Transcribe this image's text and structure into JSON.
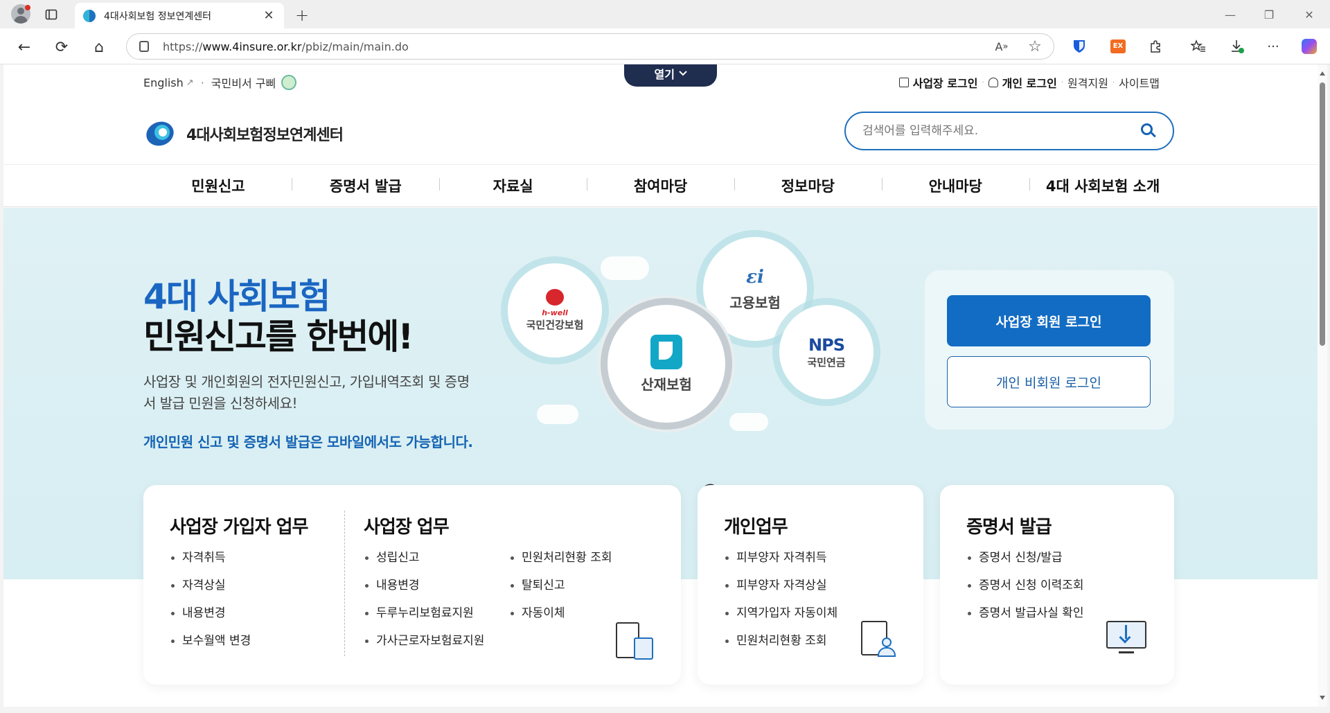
{
  "browser": {
    "tab_title": "4대사회보험 정보연계센터",
    "tab_close": "✕",
    "new_tab": "+",
    "url_prefix": "https://",
    "url_host": "www.4insure.or.kr",
    "url_path": "/pbiz/main/main.do",
    "window_controls": [
      "—",
      "❐",
      "✕"
    ],
    "nav": [
      "←",
      "⟳",
      "⌂"
    ],
    "toolbar_icons": [
      "read-aloud-icon",
      "favorite-star-icon",
      "bitwarden-icon",
      "ex-extension-icon",
      "extensions-icon",
      "favorites-icon",
      "downloads-icon",
      "more-icon",
      "copilot-icon"
    ],
    "ex_label": "EX",
    "more_label": "···"
  },
  "util": {
    "english": "English",
    "ext_link": "↗",
    "sep": "·",
    "ombudsman": "국민비서 구삐",
    "open": "열기",
    "biz_login": "사업장 로그인",
    "personal_login": "개인 로그인",
    "remote": "원격지원",
    "sitemap": "사이트맵"
  },
  "logo": {
    "text": "4대사회보험정보연계센터"
  },
  "search": {
    "placeholder": "검색어를 입력해주세요."
  },
  "gnb": [
    "민원신고",
    "증명서 발급",
    "자료실",
    "참여마당",
    "정보마당",
    "안내마당",
    "4대 사회보험 소개"
  ],
  "hero": {
    "title_line1": "4대 사회보험",
    "title_line2": "민원신고를 한번에!",
    "desc": "사업장 및 개인회원의 전자민원신고, 가입내역조회 및 증명서 발급 민원을 신청하세요!",
    "mobile_note": "개인민원 신고 및 증명서 발급은 모바일에서도 가능합니다.",
    "bubbles": {
      "health_brand": "h-well",
      "health": "국민건강보험",
      "employment": "고용보험",
      "pension_brand": "NPS",
      "pension": "국민연금",
      "industrial": "산재보험"
    },
    "btn_biz_login": "사업장 회원 로그인",
    "btn_personal_login": "개인 비회원 로그인"
  },
  "cards": {
    "biz_member": {
      "title": "사업장 가입자 업무",
      "items": [
        "자격취득",
        "자격상실",
        "내용변경",
        "보수월액 변경"
      ]
    },
    "biz": {
      "title": "사업장 업무",
      "col1": [
        "성립신고",
        "내용변경",
        "두루누리보험료지원",
        "가사근로자보험료지원"
      ],
      "col2": [
        "민원처리현황 조회",
        "탈퇴신고",
        "자동이체"
      ]
    },
    "personal": {
      "title": "개인업무",
      "items": [
        "피부양자 자격취득",
        "피부양자 자격상실",
        "지역가입자 자동이체",
        "민원처리현황 조회"
      ]
    },
    "certificate": {
      "title": "증명서 발급",
      "items": [
        "증명서 신청/발급",
        "증명서 신청 이력조회",
        "증명서 발급사실 확인"
      ]
    }
  }
}
